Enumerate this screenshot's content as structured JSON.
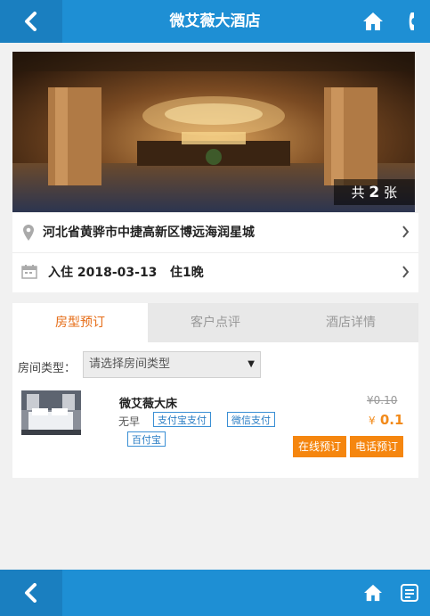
{
  "header": {
    "title": "微艾薇大酒店"
  },
  "banner": {
    "photo_count_prefix": "共",
    "photo_count": "2",
    "photo_count_unit": "张"
  },
  "address": {
    "text": "河北省黄骅市中捷高新区博远海润星城"
  },
  "stay": {
    "text": "入住 2018-03-13   住1晚"
  },
  "tabs": [
    {
      "label": "房型预订",
      "active": true
    },
    {
      "label": "客户点评",
      "active": false
    },
    {
      "label": "酒店详情",
      "active": false
    }
  ],
  "filter": {
    "label": "房间类型：",
    "selected": "请选择房间类型"
  },
  "room": {
    "name": "微艾薇大床",
    "breakfast": "无早",
    "payment_tags": [
      "支付宝支付",
      "微信支付",
      "百付宝"
    ],
    "original_price": "¥0.10",
    "price_symbol": "¥",
    "price": "0.1",
    "online_booking": "在线预订",
    "phone_booking": "电话预订"
  },
  "colors": {
    "brand": "#1e8fd4",
    "accent": "#f5860f",
    "active_tab": "#e66c16"
  },
  "icons": [
    "back-arrow-icon",
    "home-icon",
    "phone-icon",
    "location-pin-icon",
    "calendar-icon",
    "chevron-right-icon",
    "list-icon"
  ]
}
